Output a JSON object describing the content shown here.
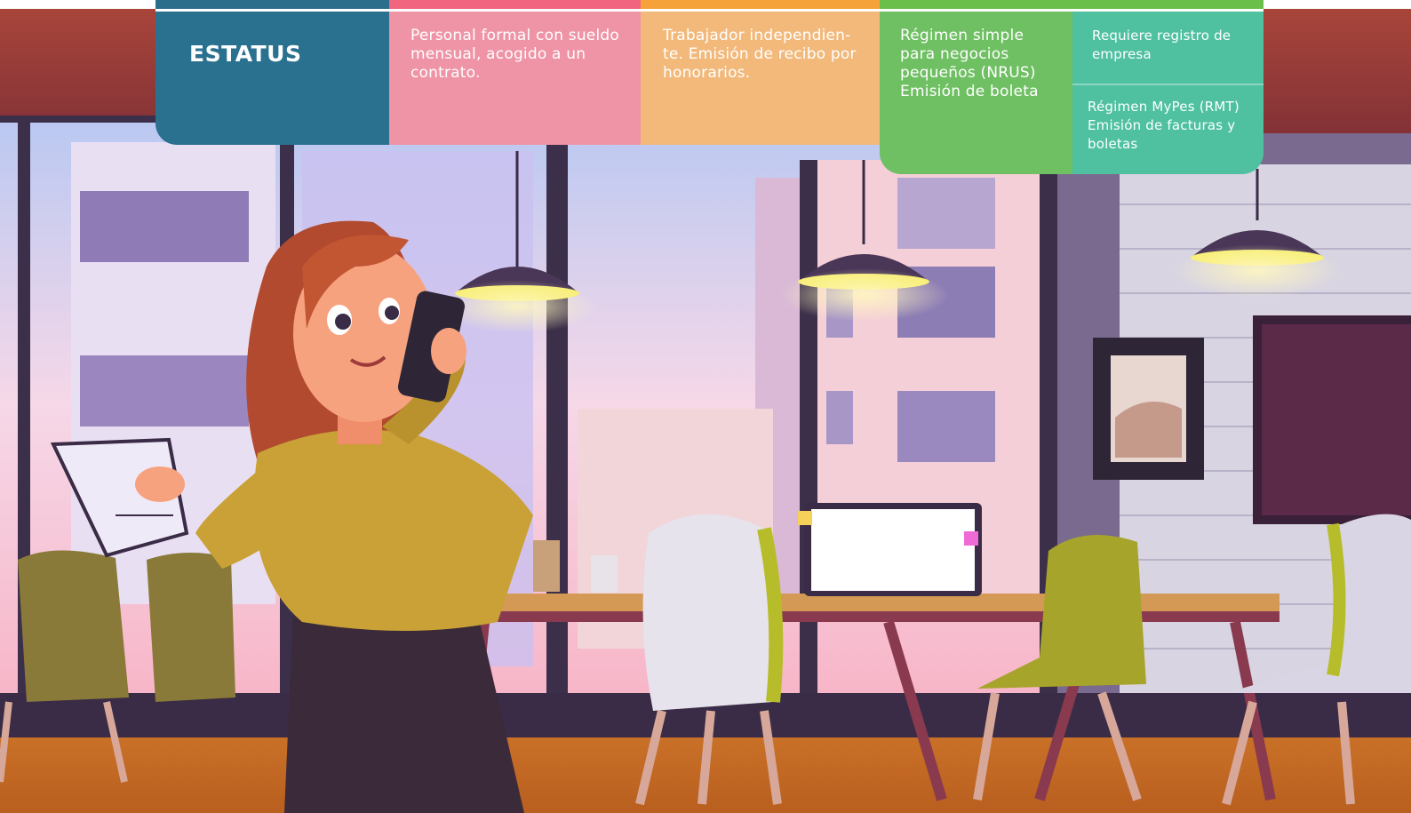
{
  "header": {
    "title": "ESTATUS",
    "col1": "Personal formal con sueldo mensual, acogido a un contrato.",
    "col2": "Trabajador independien-te. Emisión de recibo por honorarios.",
    "col3": "Régimen simple para negocios pequeños (NRUS) Emisión de boleta",
    "col4a": "Requiere registro de empresa",
    "col4b": "Régimen MyPes (RMT) Emisión de facturas y boletas"
  },
  "colors": {
    "title_bg": "#2a7190",
    "col1_bg": "#ef94a6",
    "col2_bg": "#f2b97b",
    "col3_bg": "#6fbf63",
    "col4_bg": "#4fc1a1",
    "top_blue": "#2b6e8c",
    "top_pink": "#f2657e",
    "top_orange": "#f6a23a",
    "top_green": "#69bf4a"
  },
  "scene": {
    "description_icon": "office-woman-on-phone-illustration-icon"
  }
}
